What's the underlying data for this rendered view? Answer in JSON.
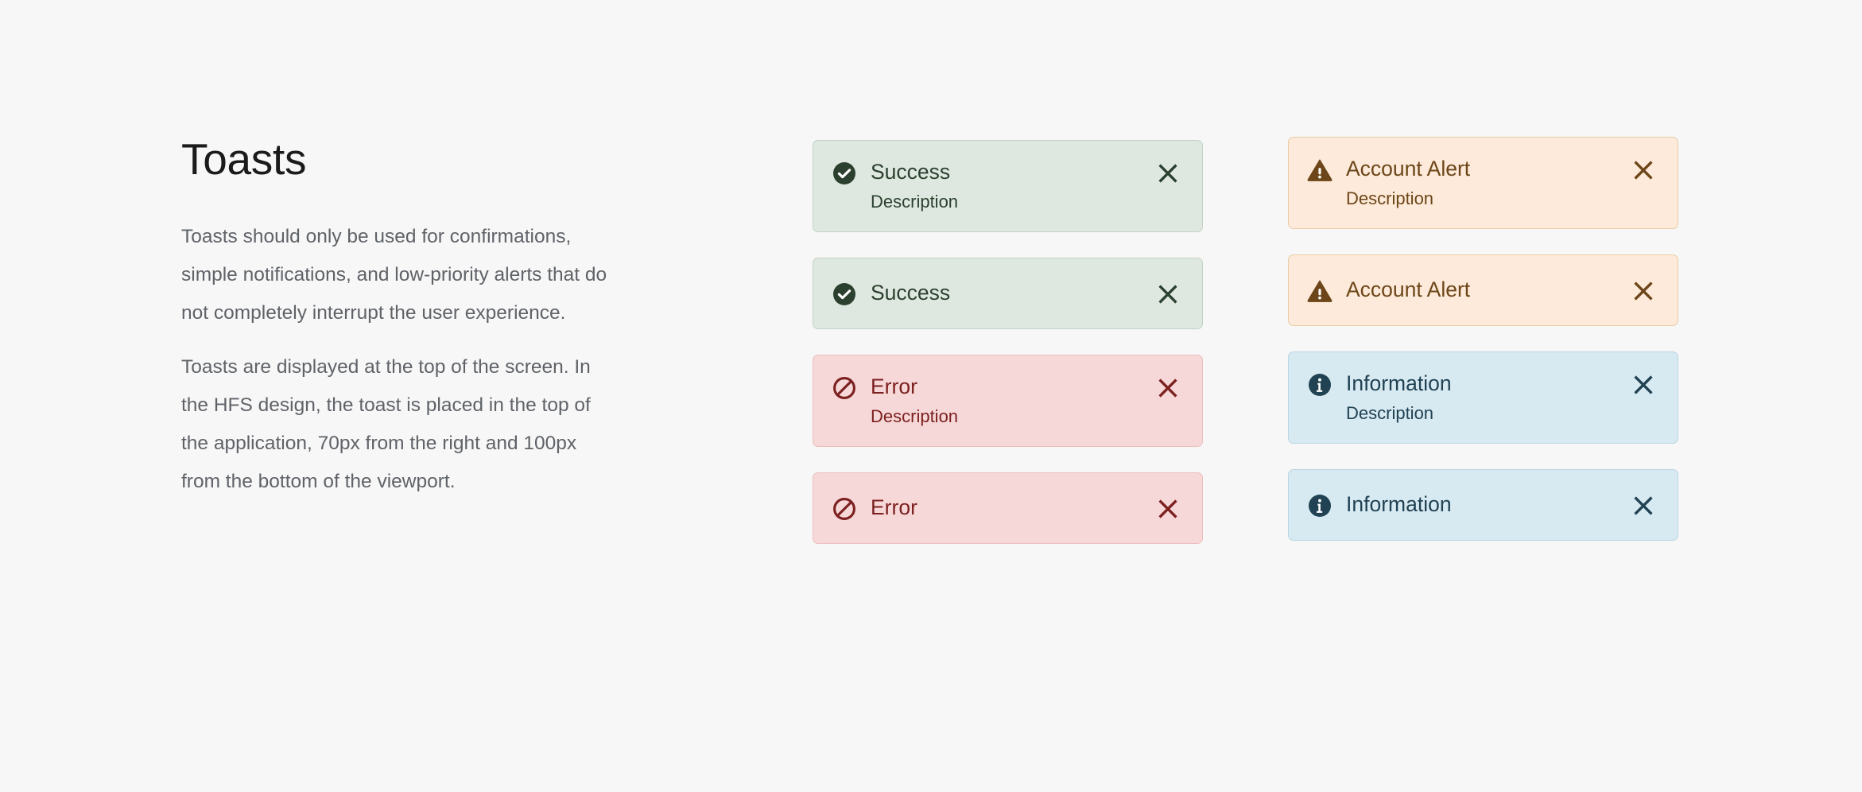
{
  "page": {
    "background": "#f7f7f7",
    "title": "Toasts",
    "paragraphs": [
      "Toasts should only be used for confirmations, simple notifications, and low-priority alerts that do not completely interrupt the user experience.",
      "Toasts are displayed at the top of the screen. In the HFS design, the toast is placed in the top of the application, 70px from the right and 100px from the bottom of the viewport."
    ]
  },
  "colors": {
    "success_bg": "#dee8e0",
    "success_border": "#c2d2c5",
    "success_fg": "#2c402f",
    "error_bg": "#f7d8d8",
    "error_border": "#edbfbf",
    "error_fg": "#7c2020",
    "warning_bg": "#fdeada",
    "warning_border": "#e9cda6",
    "warning_fg": "#6c4618",
    "info_bg": "#d7e9f1",
    "info_border": "#b9d6e3",
    "info_fg": "#204253",
    "heading_fg": "#1b1b1b",
    "body_fg": "#5f6368"
  },
  "toasts": {
    "left_column": [
      {
        "variant": "success",
        "title": "Success",
        "description": "Description",
        "icon": "check-circle-icon",
        "close_icon": "close-icon",
        "has_description": true
      },
      {
        "variant": "success",
        "title": "Success",
        "description": "",
        "icon": "check-circle-icon",
        "close_icon": "close-icon",
        "has_description": false
      },
      {
        "variant": "error",
        "title": "Error",
        "description": "Description",
        "icon": "prohibited-icon",
        "close_icon": "close-icon",
        "has_description": true
      },
      {
        "variant": "error",
        "title": "Error",
        "description": "",
        "icon": "prohibited-icon",
        "close_icon": "close-icon",
        "has_description": false
      }
    ],
    "right_column": [
      {
        "variant": "warning",
        "title": "Account Alert",
        "description": "Description",
        "icon": "warning-triangle-icon",
        "close_icon": "close-icon",
        "has_description": true
      },
      {
        "variant": "warning",
        "title": "Account Alert",
        "description": "",
        "icon": "warning-triangle-icon",
        "close_icon": "close-icon",
        "has_description": false
      },
      {
        "variant": "info",
        "title": "Information",
        "description": "Description",
        "icon": "info-circle-icon",
        "close_icon": "close-icon",
        "has_description": true
      },
      {
        "variant": "info",
        "title": "Information",
        "description": "",
        "icon": "info-circle-icon",
        "close_icon": "close-icon",
        "has_description": false
      }
    ]
  }
}
